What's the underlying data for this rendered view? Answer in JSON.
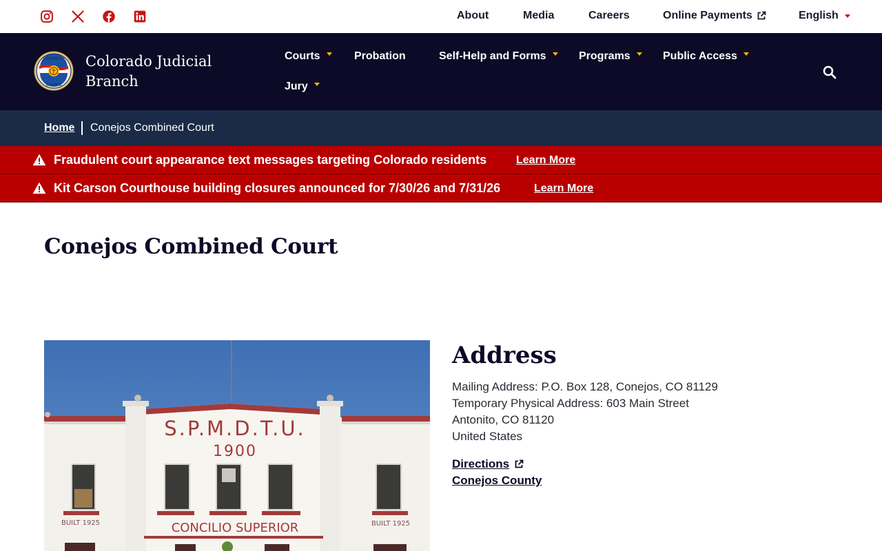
{
  "utility": {
    "social": [
      {
        "icon": "instagram-icon",
        "color": "#c81414"
      },
      {
        "icon": "x-twitter-icon",
        "color": "#c81414"
      },
      {
        "icon": "facebook-icon",
        "color": "#c81414"
      },
      {
        "icon": "linkedin-icon",
        "color": "#c81414"
      }
    ],
    "links": {
      "about": "About",
      "media": "Media",
      "careers": "Careers",
      "online_payments": "Online Payments",
      "language": "English"
    }
  },
  "header": {
    "brand_line1": "Colorado Judicial",
    "brand_line2": "Branch",
    "logo_text_top": "COLORADO",
    "logo_text_bottom": "COURTS"
  },
  "nav": {
    "courts": "Courts",
    "probation": "Probation",
    "self_help": "Self-Help and Forms",
    "programs": "Programs",
    "public_access": "Public Access",
    "jury": "Jury"
  },
  "breadcrumb": {
    "home": "Home",
    "current": "Conejos Combined Court"
  },
  "alerts": [
    {
      "text": "Fraudulent court appearance text messages targeting Colorado residents",
      "link": "Learn More"
    },
    {
      "text": "Kit Carson Courthouse building closures announced for 7/30/26 and 7/31/26",
      "link": "Learn More"
    }
  ],
  "main": {
    "title": "Conejos Combined Court",
    "photo": {
      "sign_line1": "S.P.M.D.T.U.",
      "sign_line2": "1900",
      "sign_line3": "CONCILIO SUPERIOR",
      "built_left": "BUILT 1925",
      "built_right": "BUILT 1925"
    },
    "address": {
      "heading": "Address",
      "line1": "Mailing Address: P.O. Box 128, Conejos, CO 81129",
      "line2": "Temporary Physical Address: 603 Main Street",
      "line3": "Antonito, CO 81120",
      "line4": "United States",
      "directions": "Directions",
      "county": "Conejos County"
    }
  },
  "colors": {
    "navy": "#0c0a26",
    "breadcrumb_bg": "#1b2a46",
    "alert_red": "#b90000",
    "accent_gold": "#f5b800",
    "accent_red": "#c81414"
  }
}
